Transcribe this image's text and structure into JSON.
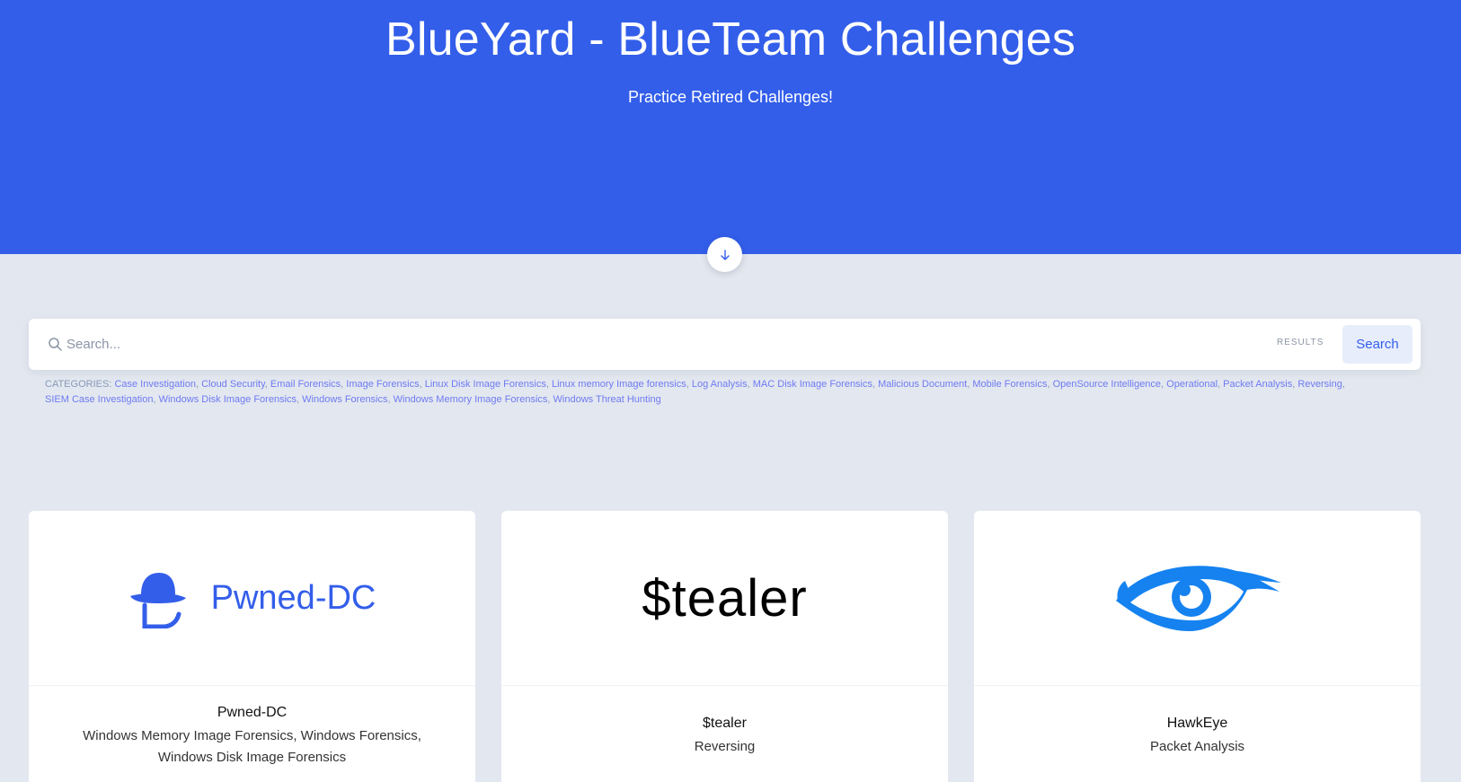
{
  "hero": {
    "title": "BlueYard - BlueTeam Challenges",
    "subtitle": "Practice Retired Challenges!",
    "scroll_icon": "arrow-down-icon"
  },
  "search": {
    "placeholder": "Search...",
    "value": "",
    "results_label": "RESULTS",
    "button_label": "Search",
    "icon": "search-icon"
  },
  "categories": {
    "label": "CATEGORIES:",
    "items": [
      "Case Investigation",
      "Cloud Security",
      "Email Forensics",
      "Image Forensics",
      "Linux Disk Image Forensics",
      "Linux memory Image forensics",
      "Log Analysis",
      "MAC Disk Image Forensics",
      "Malicious Document",
      "Mobile Forensics",
      "OpenSource Intelligence",
      "Operational",
      "Packet Analysis",
      "Reversing",
      "SIEM Case Investigation",
      "Windows Disk Image Forensics",
      "Windows Forensics",
      "Windows Memory Image Forensics",
      "Windows Threat Hunting"
    ]
  },
  "cards": [
    {
      "logo_text": "Pwned-DC",
      "logo_icon": "hat-logo-icon",
      "title": "Pwned-DC",
      "categories": "Windows Memory Image Forensics, Windows Forensics, Windows Disk Image Forensics"
    },
    {
      "logo_text": "$tealer",
      "title": "$tealer",
      "categories": "Reversing"
    },
    {
      "logo_icon": "eye-logo-icon",
      "title": "HawkEye",
      "categories": "Packet Analysis"
    }
  ],
  "colors": {
    "primary": "#335eea",
    "background": "#e3e7ef",
    "category_link": "#6e7bf2",
    "muted": "#869ab8"
  }
}
